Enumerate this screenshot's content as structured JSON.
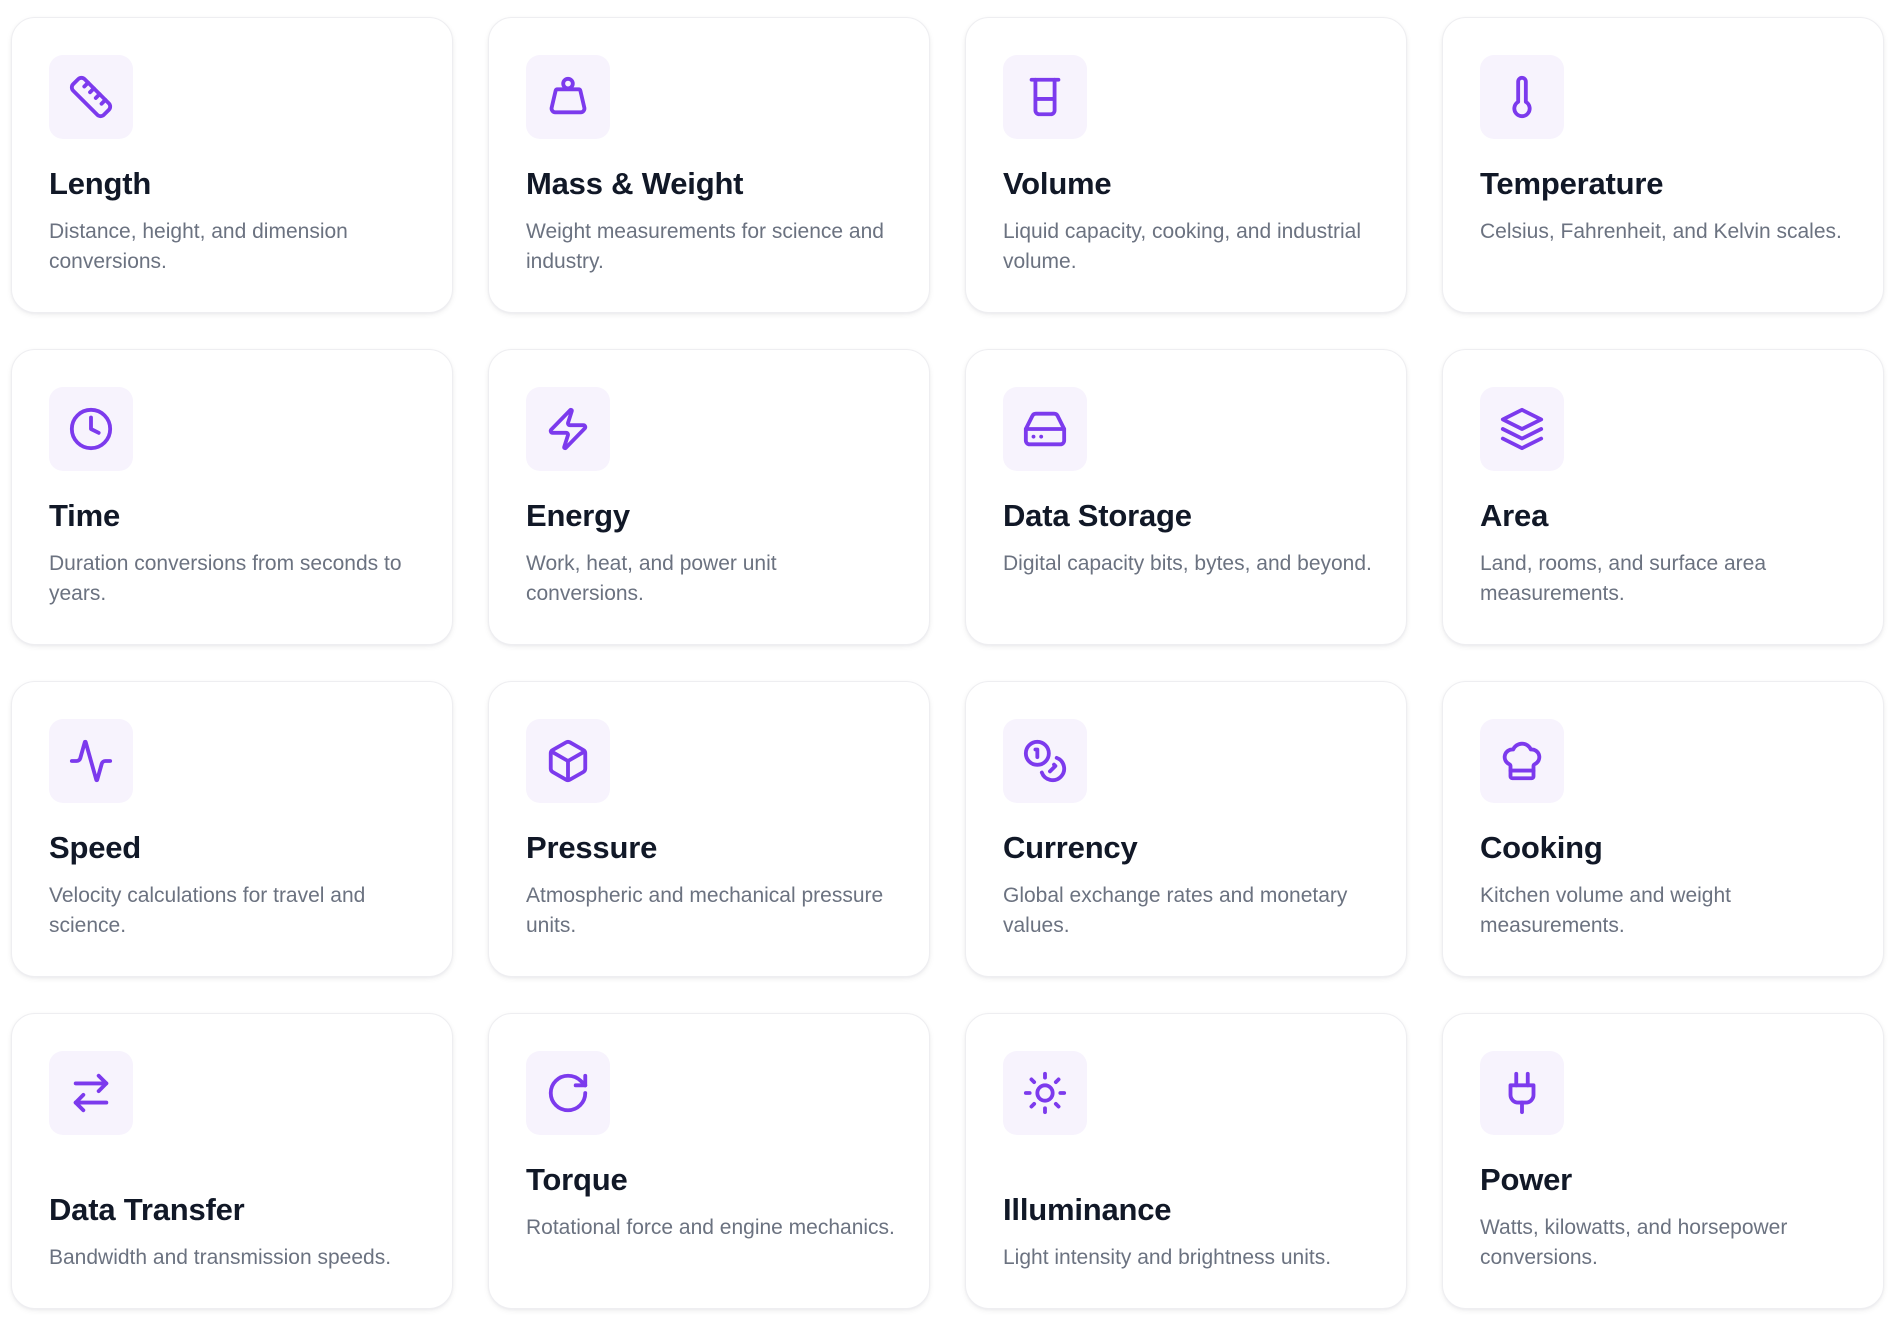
{
  "accent_color": "#7c3aed",
  "categories": [
    {
      "title": "Length",
      "description": "Distance, height, and dimension conversions.",
      "icon": "ruler-icon"
    },
    {
      "title": "Mass & Weight",
      "description": "Weight measurements for science and industry.",
      "icon": "weight-icon"
    },
    {
      "title": "Volume",
      "description": "Liquid capacity, cooking, and industrial volume.",
      "icon": "beaker-icon"
    },
    {
      "title": "Temperature",
      "description": "Celsius, Fahrenheit, and Kelvin scales.",
      "icon": "thermometer-icon"
    },
    {
      "title": "Time",
      "description": "Duration conversions from seconds to years.",
      "icon": "clock-icon"
    },
    {
      "title": "Energy",
      "description": "Work, heat, and power unit conversions.",
      "icon": "lightning-icon"
    },
    {
      "title": "Data Storage",
      "description": "Digital capacity bits, bytes, and beyond.",
      "icon": "hard-drive-icon"
    },
    {
      "title": "Area",
      "description": "Land, rooms, and surface area measurements.",
      "icon": "layers-icon"
    },
    {
      "title": "Speed",
      "description": "Velocity calculations for travel and science.",
      "icon": "activity-icon"
    },
    {
      "title": "Pressure",
      "description": "Atmospheric and mechanical pressure units.",
      "icon": "box-icon"
    },
    {
      "title": "Currency",
      "description": "Global exchange rates and monetary values.",
      "icon": "coins-icon"
    },
    {
      "title": "Cooking",
      "description": "Kitchen volume and weight measurements.",
      "icon": "chef-hat-icon"
    },
    {
      "title": "Data Transfer",
      "description": "Bandwidth and transmission speeds.",
      "icon": "arrows-swap-icon"
    },
    {
      "title": "Torque",
      "description": "Rotational force and engine mechanics.",
      "icon": "rotate-icon"
    },
    {
      "title": "Illuminance",
      "description": "Light intensity and brightness units.",
      "icon": "sun-icon"
    },
    {
      "title": "Power",
      "description": "Watts, kilowatts, and horsepower conversions.",
      "icon": "plug-icon"
    }
  ]
}
